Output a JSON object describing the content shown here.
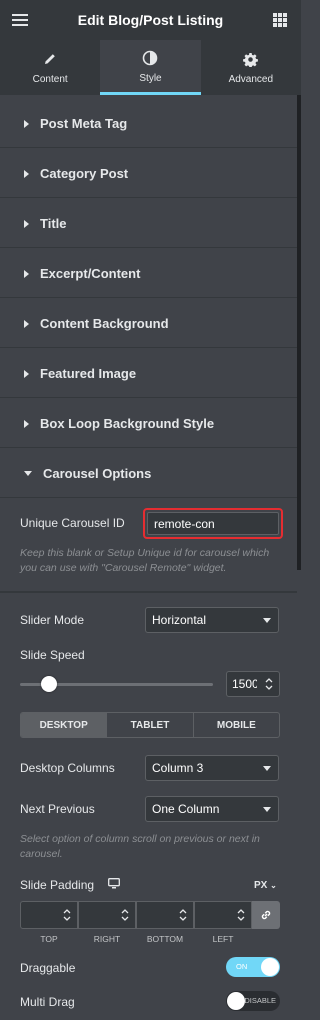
{
  "header": {
    "title": "Edit Blog/Post Listing",
    "menu_icon": "hamburger-icon",
    "apps_icon": "grid-icon"
  },
  "tabs": [
    {
      "label": "Content",
      "icon": "pencil-icon",
      "active": false
    },
    {
      "label": "Style",
      "icon": "half-circle-icon",
      "active": true
    },
    {
      "label": "Advanced",
      "icon": "gear-icon",
      "active": false
    }
  ],
  "sections": [
    {
      "label": "Post Meta Tag",
      "expanded": false
    },
    {
      "label": "Category Post",
      "expanded": false
    },
    {
      "label": "Title",
      "expanded": false
    },
    {
      "label": "Excerpt/Content",
      "expanded": false
    },
    {
      "label": "Content Background",
      "expanded": false
    },
    {
      "label": "Featured Image",
      "expanded": false
    },
    {
      "label": "Box Loop Background Style",
      "expanded": false
    },
    {
      "label": "Carousel Options",
      "expanded": true
    }
  ],
  "carousel": {
    "unique_id_label": "Unique Carousel ID",
    "unique_id_value": "remote-con",
    "unique_id_desc": "Keep this blank or Setup Unique id for carousel which you can use with \"Carousel Remote\" widget.",
    "slider_mode_label": "Slider Mode",
    "slider_mode_value": "Horizontal",
    "slide_speed_label": "Slide Speed",
    "slide_speed_value": "1500",
    "devices": [
      "DESKTOP",
      "TABLET",
      "MOBILE"
    ],
    "active_device": "DESKTOP",
    "desktop_columns_label": "Desktop Columns",
    "desktop_columns_value": "Column 3",
    "next_previous_label": "Next Previous",
    "next_previous_value": "One Column",
    "next_previous_desc": "Select option of column scroll on previous or next in carousel.",
    "slide_padding_label": "Slide Padding",
    "slide_padding_units": "PX",
    "padding_sides": [
      "TOP",
      "RIGHT",
      "BOTTOM",
      "LEFT"
    ],
    "draggable_label": "Draggable",
    "draggable_state": "ON",
    "multi_drag_label": "Multi Drag",
    "multi_drag_state": "DISABLE"
  },
  "colors": {
    "accent": "#71d7f7",
    "highlight_border": "#e52d31",
    "panel": "#404349",
    "header": "#34383c"
  }
}
